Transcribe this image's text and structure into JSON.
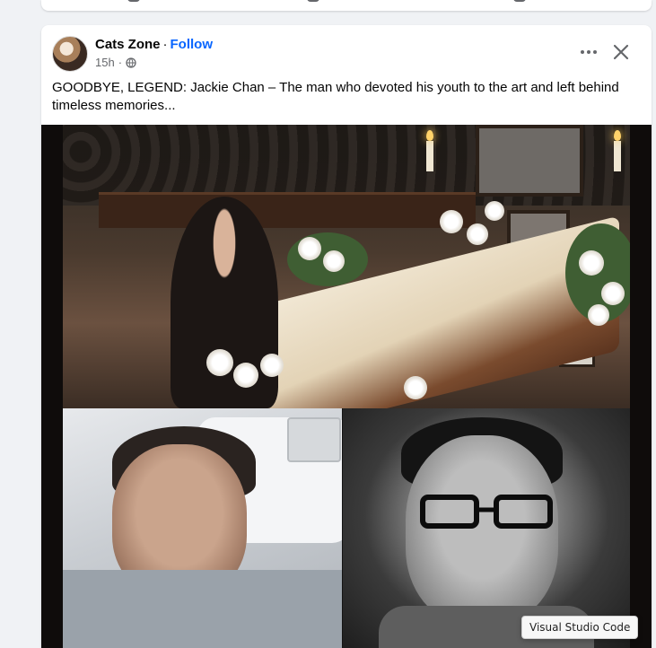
{
  "post": {
    "author": "Cats Zone",
    "separator": "·",
    "follow_label": "Follow",
    "timestamp": "15h",
    "separator2": "·",
    "caption": "GOODBYE, LEGEND: Jackie Chan – The man who devoted his youth to the art and left behind timeless memories..."
  },
  "icons": {
    "more": "more-options-icon",
    "close": "close-icon",
    "privacy": "globe-icon"
  },
  "tooltip": {
    "text": "Visual Studio Code"
  },
  "colors": {
    "link": "#0866ff",
    "secondary_text": "#65676b",
    "card": "#ffffff",
    "background": "#f0f2f5"
  }
}
